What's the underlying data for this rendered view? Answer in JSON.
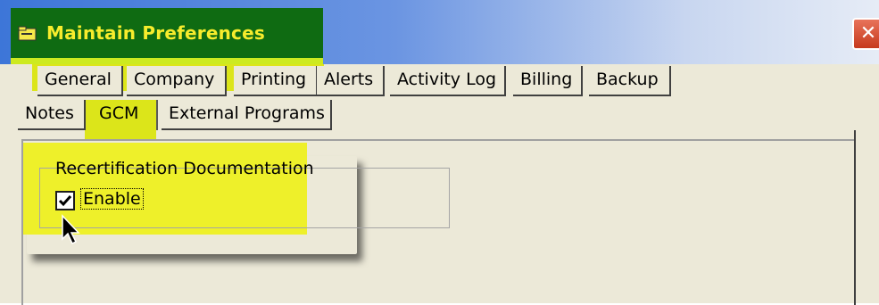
{
  "window": {
    "title": "Maintain Preferences",
    "close_label": "✕"
  },
  "tabs": {
    "row1": [
      "General",
      "Company",
      "Printing",
      "Alerts",
      "Activity Log",
      "Billing",
      "Backup"
    ],
    "row2": [
      "Notes",
      "GCM",
      "External Programs"
    ],
    "active": "GCM"
  },
  "group": {
    "legend": "Recertification Documentation",
    "enable_label": "Enable",
    "enable_checked": true
  },
  "colors": {
    "highlight": "#e4ec1c",
    "title_text": "#f7ec2c",
    "title_bg": "#0f6b12",
    "window_face": "#ece9d8"
  },
  "icons": [
    "window-app-icon",
    "close-icon",
    "checkmark-icon",
    "mouse-cursor-icon"
  ]
}
